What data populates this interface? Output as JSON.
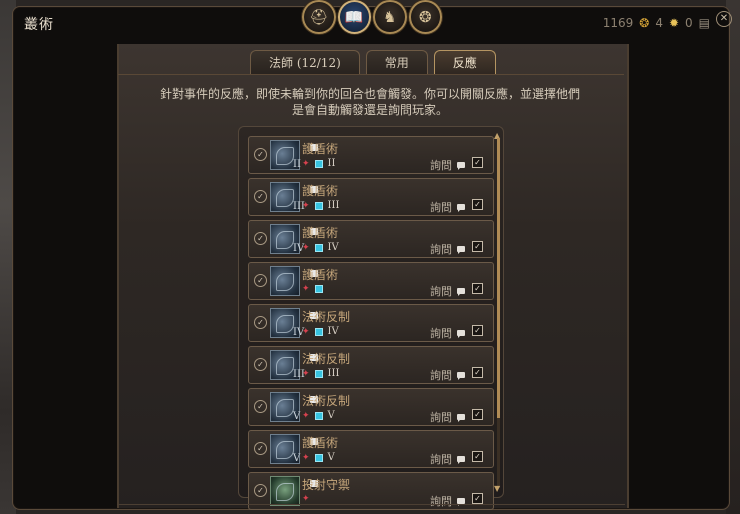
{
  "window": {
    "title": "叢術"
  },
  "top_nav": [
    {
      "icon": "helmet-icon",
      "glyph": "⛑"
    },
    {
      "icon": "spellbook-icon",
      "glyph": "📖",
      "active": true
    },
    {
      "icon": "chess-knight-icon",
      "glyph": "♞"
    },
    {
      "icon": "party-icon",
      "glyph": "❂"
    }
  ],
  "currency": {
    "gold": "1169",
    "star": "4",
    "books": "0"
  },
  "tabs": [
    {
      "label": "法師 (12/12)"
    },
    {
      "label": "常用"
    },
    {
      "label": "反應",
      "active": true
    }
  ],
  "description": {
    "line1": "針對事件的反應，即使未輪到你的回合也會觸發。你可以開關反應，並選擇他們",
    "line2": "是會自動觸發還是詢問玩家。"
  },
  "reactions": [
    {
      "name": "護盾術",
      "level": "II",
      "ask": "詢問",
      "icon_level": "II",
      "icon_style": "blue"
    },
    {
      "name": "護盾術",
      "level": "III",
      "ask": "詢問",
      "icon_level": "III",
      "icon_style": "blue"
    },
    {
      "name": "護盾術",
      "level": "IV",
      "ask": "詢問",
      "icon_level": "IV",
      "icon_style": "blue"
    },
    {
      "name": "護盾術",
      "level": "",
      "ask": "詢問",
      "icon_level": "",
      "icon_style": "blue"
    },
    {
      "name": "法術反制",
      "level": "IV",
      "ask": "詢問",
      "icon_level": "IV",
      "icon_style": "blue"
    },
    {
      "name": "法術反制",
      "level": "III",
      "ask": "詢問",
      "icon_level": "III",
      "icon_style": "blue"
    },
    {
      "name": "法術反制",
      "level": "V",
      "ask": "詢問",
      "icon_level": "V",
      "icon_style": "blue"
    },
    {
      "name": "護盾術",
      "level": "V",
      "ask": "詢問",
      "icon_level": "V",
      "icon_style": "blue"
    },
    {
      "name": "投射守禦",
      "level": "",
      "ask": "詢問",
      "icon_level": "",
      "icon_style": "green",
      "no_square": true
    }
  ],
  "colors": {
    "accent_gold": "#b59562",
    "slot_red": "#d8424f",
    "slot_cyan": "#37c3e0"
  }
}
